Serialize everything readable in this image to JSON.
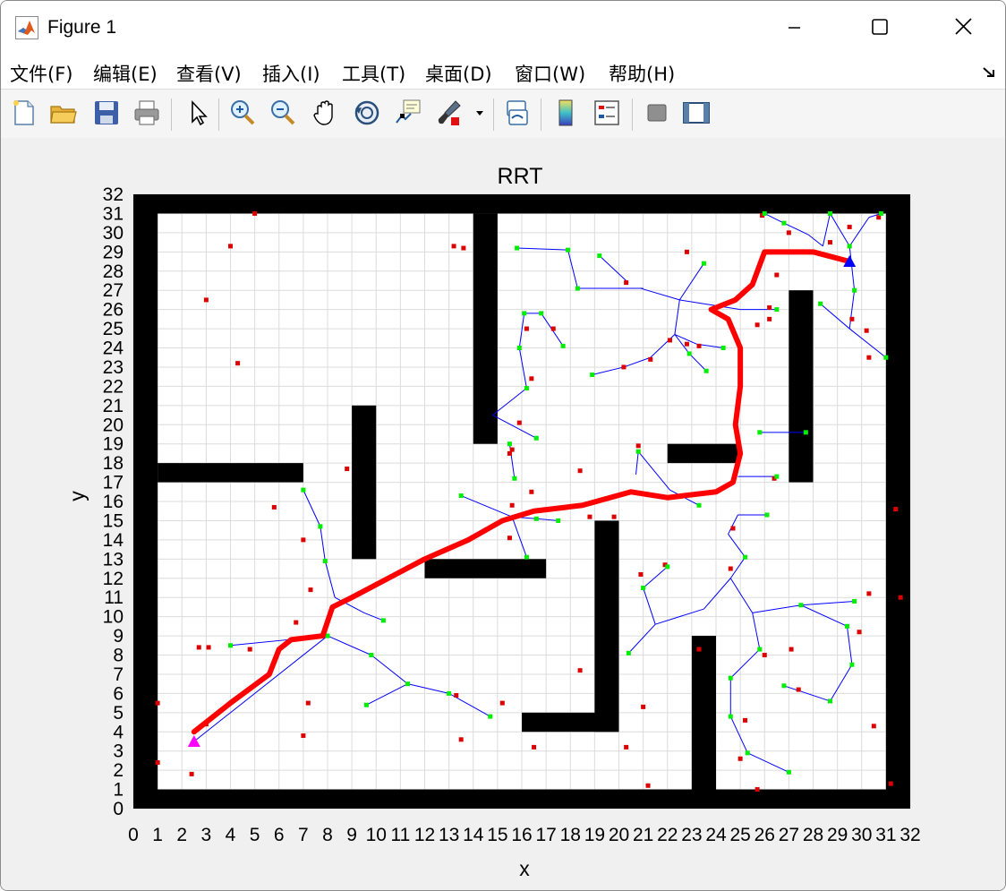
{
  "window": {
    "title": "Figure 1",
    "icon": "matlab-logo-icon",
    "controls": [
      "minimize-icon",
      "maximize-icon",
      "close-icon"
    ]
  },
  "menu": {
    "items": [
      {
        "label": "文件(F)",
        "name": "menu-file"
      },
      {
        "label": "编辑(E)",
        "name": "menu-edit"
      },
      {
        "label": "查看(V)",
        "name": "menu-view"
      },
      {
        "label": "插入(I)",
        "name": "menu-insert"
      },
      {
        "label": "工具(T)",
        "name": "menu-tools"
      },
      {
        "label": "桌面(D)",
        "name": "menu-desktop"
      },
      {
        "label": "窗口(W)",
        "name": "menu-window"
      },
      {
        "label": "帮助(H)",
        "name": "menu-help"
      }
    ]
  },
  "toolbar": {
    "icons": [
      "new-figure-icon",
      "open-file-icon",
      "save-icon",
      "print-icon",
      "pointer-icon",
      "zoom-in-icon",
      "zoom-out-icon",
      "pan-hand-icon",
      "rotate-3d-icon",
      "data-cursor-icon",
      "brush-icon",
      "brush-dropdown-icon",
      "link-plot-icon",
      "colorbar-icon",
      "legend-icon",
      "hide-plot-tools-icon",
      "show-plot-tools-icon"
    ]
  },
  "colors": {
    "path": "#ff0000",
    "tree": "#0000ff",
    "node": "#00ee00",
    "sample": "#dd0000",
    "obstacle": "#000000",
    "start": "#ff00ff",
    "goal": "#0000ff"
  },
  "chart_data": {
    "type": "scatter",
    "title": "RRT",
    "xlabel": "x",
    "ylabel": "y",
    "xlim": [
      0,
      32
    ],
    "ylim": [
      0,
      32
    ],
    "xticks": [
      "0",
      "1",
      "2",
      "3",
      "4",
      "5",
      "6",
      "7",
      "8",
      "9",
      "10",
      "11",
      "12",
      "13",
      "14",
      "15",
      "16",
      "17",
      "18",
      "19",
      "20",
      "21",
      "22",
      "23",
      "24",
      "25",
      "26",
      "27",
      "28",
      "29",
      "30",
      "31",
      "32"
    ],
    "yticks": [
      "0",
      "1",
      "2",
      "3",
      "4",
      "5",
      "6",
      "7",
      "8",
      "9",
      "10",
      "11",
      "12",
      "13",
      "14",
      "15",
      "16",
      "17",
      "18",
      "19",
      "20",
      "21",
      "22",
      "23",
      "24",
      "25",
      "26",
      "27",
      "28",
      "29",
      "30",
      "31",
      "32"
    ],
    "grid": true,
    "start": [
      2.5,
      3.5
    ],
    "goal": [
      29.5,
      28.5
    ],
    "obstacles": [
      [
        0,
        0,
        1,
        32
      ],
      [
        31,
        0,
        1,
        32
      ],
      [
        0,
        0,
        32,
        1
      ],
      [
        0,
        31,
        32,
        1
      ],
      [
        1,
        17,
        6,
        1
      ],
      [
        9,
        13,
        1,
        8
      ],
      [
        14,
        19,
        1,
        12
      ],
      [
        12,
        12,
        5,
        1
      ],
      [
        16,
        4,
        4,
        1
      ],
      [
        19,
        4,
        1,
        11
      ],
      [
        22,
        18,
        3,
        1
      ],
      [
        23,
        0,
        1,
        9
      ],
      [
        27,
        17,
        1,
        10
      ]
    ],
    "path": [
      [
        2.5,
        4
      ],
      [
        4,
        5.5
      ],
      [
        5.6,
        7
      ],
      [
        6,
        8.3
      ],
      [
        6.5,
        8.8
      ],
      [
        7.8,
        9
      ],
      [
        8.2,
        10.5
      ],
      [
        9,
        11
      ],
      [
        10.5,
        12
      ],
      [
        12,
        13
      ],
      [
        13.8,
        14
      ],
      [
        15.2,
        15
      ],
      [
        16.5,
        15.5
      ],
      [
        18.5,
        15.8
      ],
      [
        20.5,
        16.5
      ],
      [
        22,
        16.2
      ],
      [
        24,
        16.5
      ],
      [
        24.7,
        17
      ],
      [
        25,
        18.5
      ],
      [
        24.8,
        20
      ],
      [
        25,
        22
      ],
      [
        25,
        24
      ],
      [
        24.5,
        25.5
      ],
      [
        23.8,
        26
      ],
      [
        24.8,
        26.5
      ],
      [
        25.5,
        27.3
      ],
      [
        26,
        29
      ],
      [
        28,
        29
      ],
      [
        29.5,
        28.5
      ]
    ],
    "tree": [
      [
        [
          2.5,
          3.5
        ],
        [
          8,
          9
        ]
      ],
      [
        [
          4,
          8.5
        ],
        [
          8,
          9
        ]
      ],
      [
        [
          8,
          9
        ],
        [
          9.8,
          8
        ]
      ],
      [
        [
          9.8,
          8
        ],
        [
          11.3,
          6.5
        ]
      ],
      [
        [
          11.3,
          6.5
        ],
        [
          9.6,
          5.4
        ]
      ],
      [
        [
          11.3,
          6.5
        ],
        [
          13,
          6
        ]
      ],
      [
        [
          13,
          6
        ],
        [
          14.7,
          4.8
        ]
      ],
      [
        [
          7,
          16.6
        ],
        [
          7.7,
          14.7
        ]
      ],
      [
        [
          7.7,
          14.7
        ],
        [
          7.9,
          12.9
        ]
      ],
      [
        [
          7.9,
          12.9
        ],
        [
          8.3,
          11
        ]
      ],
      [
        [
          8.3,
          11
        ],
        [
          9.5,
          10.2
        ]
      ],
      [
        [
          9.5,
          10.2
        ],
        [
          10.3,
          9.8
        ]
      ],
      [
        [
          13.5,
          16.3
        ],
        [
          15.6,
          15.2
        ]
      ],
      [
        [
          15.6,
          15.2
        ],
        [
          16.6,
          15.1
        ]
      ],
      [
        [
          16.6,
          15.1
        ],
        [
          17.5,
          15
        ]
      ],
      [
        [
          15.6,
          15.2
        ],
        [
          16.2,
          13.1
        ]
      ],
      [
        [
          15.5,
          19
        ],
        [
          15.7,
          17.2
        ]
      ],
      [
        [
          14.8,
          20.5
        ],
        [
          16.2,
          21.9
        ]
      ],
      [
        [
          14.8,
          20.5
        ],
        [
          16.6,
          19.3
        ]
      ],
      [
        [
          16.2,
          21.9
        ],
        [
          15.9,
          24
        ]
      ],
      [
        [
          15.9,
          24
        ],
        [
          16.1,
          25.8
        ]
      ],
      [
        [
          16.1,
          25.8
        ],
        [
          16.8,
          25.8
        ]
      ],
      [
        [
          16.8,
          25.8
        ],
        [
          17.7,
          24.1
        ]
      ],
      [
        [
          15.8,
          29.2
        ],
        [
          17.9,
          29.1
        ]
      ],
      [
        [
          17.9,
          29.1
        ],
        [
          18.3,
          27.1
        ]
      ],
      [
        [
          18.3,
          27.1
        ],
        [
          20.9,
          27.1
        ]
      ],
      [
        [
          18.3,
          27.1
        ],
        [
          21,
          27.1
        ]
      ],
      [
        [
          19.2,
          28.8
        ],
        [
          20.3,
          27.5
        ]
      ],
      [
        [
          20.9,
          27.1
        ],
        [
          22.5,
          26.5
        ]
      ],
      [
        [
          22.5,
          26.5
        ],
        [
          23.5,
          28.4
        ]
      ],
      [
        [
          22.5,
          26.5
        ],
        [
          22.3,
          24.7
        ]
      ],
      [
        [
          22.3,
          24.7
        ],
        [
          22.9,
          23.7
        ]
      ],
      [
        [
          22.9,
          23.7
        ],
        [
          23.6,
          22.8
        ]
      ],
      [
        [
          22.3,
          24.7
        ],
        [
          23.2,
          24.2
        ]
      ],
      [
        [
          23.2,
          24.2
        ],
        [
          24.3,
          24
        ]
      ],
      [
        [
          22.5,
          26.5
        ],
        [
          25,
          26
        ]
      ],
      [
        [
          25,
          26
        ],
        [
          26.5,
          26
        ]
      ],
      [
        [
          18.9,
          22.6
        ],
        [
          20.2,
          23
        ]
      ],
      [
        [
          20.2,
          23
        ],
        [
          21.3,
          23.5
        ]
      ],
      [
        [
          21.3,
          23.5
        ],
        [
          22.3,
          24.7
        ]
      ],
      [
        [
          25.8,
          19.6
        ],
        [
          27.7,
          19.6
        ]
      ],
      [
        [
          24.9,
          17.3
        ],
        [
          26.5,
          17.3
        ]
      ],
      [
        [
          20.7,
          17.4
        ],
        [
          20.8,
          18.6
        ]
      ],
      [
        [
          20.8,
          18.6
        ],
        [
          22.1,
          16.6
        ]
      ],
      [
        [
          22.1,
          16.6
        ],
        [
          23.3,
          15.8
        ]
      ],
      [
        [
          24.9,
          15.3
        ],
        [
          26.1,
          15.3
        ]
      ],
      [
        [
          24.9,
          15.3
        ],
        [
          24.5,
          14.3
        ]
      ],
      [
        [
          24.5,
          14.3
        ],
        [
          25.2,
          13.1
        ]
      ],
      [
        [
          25.2,
          13.1
        ],
        [
          24.6,
          12
        ]
      ],
      [
        [
          24.6,
          12
        ],
        [
          23.5,
          10.4
        ]
      ],
      [
        [
          23.5,
          10.4
        ],
        [
          21.5,
          9.6
        ]
      ],
      [
        [
          21.5,
          9.6
        ],
        [
          21,
          11.5
        ]
      ],
      [
        [
          21,
          11.5
        ],
        [
          22,
          12.6
        ]
      ],
      [
        [
          21.5,
          9.6
        ],
        [
          20.4,
          8.1
        ]
      ],
      [
        [
          24.6,
          12
        ],
        [
          25.5,
          10.2
        ]
      ],
      [
        [
          25.5,
          10.2
        ],
        [
          27.5,
          10.6
        ]
      ],
      [
        [
          27.5,
          10.6
        ],
        [
          29.4,
          9.5
        ]
      ],
      [
        [
          29.4,
          9.5
        ],
        [
          29.6,
          7.5
        ]
      ],
      [
        [
          29.6,
          7.5
        ],
        [
          28.7,
          5.6
        ]
      ],
      [
        [
          28.7,
          5.6
        ],
        [
          26.8,
          6.4
        ]
      ],
      [
        [
          27.5,
          10.6
        ],
        [
          29.7,
          10.8
        ]
      ],
      [
        [
          25.5,
          10.2
        ],
        [
          25.8,
          8.3
        ]
      ],
      [
        [
          25.8,
          8.3
        ],
        [
          24.6,
          6.8
        ]
      ],
      [
        [
          24.6,
          6.8
        ],
        [
          24.6,
          4.8
        ]
      ],
      [
        [
          24.6,
          4.8
        ],
        [
          25.3,
          2.9
        ]
      ],
      [
        [
          25.3,
          2.9
        ],
        [
          27,
          1.9
        ]
      ],
      [
        [
          26,
          31
        ],
        [
          26.8,
          30.5
        ]
      ],
      [
        [
          26.8,
          30.5
        ],
        [
          27.8,
          29.9
        ]
      ],
      [
        [
          27.8,
          29.9
        ],
        [
          28.4,
          29.3
        ]
      ],
      [
        [
          28.4,
          29.3
        ],
        [
          28.7,
          31
        ]
      ],
      [
        [
          28.7,
          31
        ],
        [
          29.5,
          29.3
        ]
      ],
      [
        [
          29.5,
          29.3
        ],
        [
          30.3,
          30.8
        ]
      ],
      [
        [
          30.3,
          30.8
        ],
        [
          30.8,
          31
        ]
      ],
      [
        [
          29.5,
          29.3
        ],
        [
          29.7,
          27
        ]
      ],
      [
        [
          29.7,
          27
        ],
        [
          29.5,
          25
        ]
      ],
      [
        [
          29.5,
          25
        ],
        [
          31,
          23.5
        ]
      ],
      [
        [
          29.5,
          25
        ],
        [
          28.3,
          26.3
        ]
      ]
    ],
    "nodes": [
      [
        2.5,
        3.5
      ],
      [
        4,
        8.5
      ],
      [
        8,
        9
      ],
      [
        9.8,
        8
      ],
      [
        11.3,
        6.5
      ],
      [
        9.6,
        5.4
      ],
      [
        13,
        6
      ],
      [
        14.7,
        4.8
      ],
      [
        7,
        16.6
      ],
      [
        7.7,
        14.7
      ],
      [
        7.9,
        12.9
      ],
      [
        10.3,
        9.8
      ],
      [
        13.5,
        16.3
      ],
      [
        16.6,
        15.1
      ],
      [
        17.5,
        15
      ],
      [
        16.2,
        13.1
      ],
      [
        15.5,
        19
      ],
      [
        15.7,
        17.2
      ],
      [
        16.2,
        21.9
      ],
      [
        16.6,
        19.3
      ],
      [
        15.9,
        24
      ],
      [
        16.1,
        25.8
      ],
      [
        16.8,
        25.8
      ],
      [
        17.7,
        24.1
      ],
      [
        15.8,
        29.2
      ],
      [
        17.9,
        29.1
      ],
      [
        18.3,
        27.1
      ],
      [
        19.2,
        28.8
      ],
      [
        23.5,
        28.4
      ],
      [
        22.9,
        23.7
      ],
      [
        23.6,
        22.8
      ],
      [
        24.3,
        24
      ],
      [
        18.9,
        22.6
      ],
      [
        25.8,
        19.6
      ],
      [
        27.7,
        19.6
      ],
      [
        26.5,
        17.3
      ],
      [
        20.8,
        18.6
      ],
      [
        23.3,
        15.8
      ],
      [
        26.1,
        15.3
      ],
      [
        25.2,
        13.1
      ],
      [
        22,
        12.6
      ],
      [
        21,
        11.5
      ],
      [
        20.4,
        8.1
      ],
      [
        27.5,
        10.6
      ],
      [
        29.4,
        9.5
      ],
      [
        29.6,
        7.5
      ],
      [
        28.7,
        5.6
      ],
      [
        26.8,
        6.4
      ],
      [
        29.7,
        10.8
      ],
      [
        25.8,
        8.3
      ],
      [
        24.6,
        6.8
      ],
      [
        24.6,
        4.8
      ],
      [
        25.3,
        2.9
      ],
      [
        27,
        1.9
      ],
      [
        26,
        31
      ],
      [
        26.5,
        26
      ],
      [
        26.8,
        30.5
      ],
      [
        28.7,
        31
      ],
      [
        29.5,
        29.3
      ],
      [
        30.8,
        31
      ],
      [
        29.7,
        27
      ],
      [
        31,
        23.5
      ],
      [
        28.3,
        26.3
      ]
    ],
    "samples": [
      [
        4,
        29.3
      ],
      [
        3,
        26.5
      ],
      [
        4.3,
        23.2
      ],
      [
        5,
        31
      ],
      [
        13.2,
        29.3
      ],
      [
        13.6,
        29.2
      ],
      [
        22.8,
        29
      ],
      [
        8.8,
        17.7
      ],
      [
        5.8,
        15.7
      ],
      [
        7,
        14
      ],
      [
        7.3,
        11.4
      ],
      [
        6.7,
        9.7
      ],
      [
        2.7,
        8.4
      ],
      [
        3.1,
        8.4
      ],
      [
        4.8,
        8.3
      ],
      [
        3,
        4.4
      ],
      [
        1,
        5.5
      ],
      [
        1,
        2.4
      ],
      [
        2.4,
        1.8
      ],
      [
        7.2,
        5.5
      ],
      [
        7,
        3.8
      ],
      [
        13.3,
        5.9
      ],
      [
        13.5,
        3.6
      ],
      [
        15.2,
        5.5
      ],
      [
        16.5,
        3.2
      ],
      [
        18.4,
        7.2
      ],
      [
        21,
        5.3
      ],
      [
        20.3,
        3.2
      ],
      [
        21.2,
        1.2
      ],
      [
        18.4,
        17.6
      ],
      [
        18.8,
        15.2
      ],
      [
        19.8,
        15.2
      ],
      [
        20.8,
        18.9
      ],
      [
        15.5,
        18.5
      ],
      [
        16.4,
        16.5
      ],
      [
        15.6,
        15.8
      ],
      [
        15.5,
        14.1
      ],
      [
        20.9,
        12.2
      ],
      [
        21.9,
        12.7
      ],
      [
        23.3,
        8.3
      ],
      [
        24.7,
        14.6
      ],
      [
        24.6,
        12.5
      ],
      [
        26,
        8
      ],
      [
        27.1,
        8.3
      ],
      [
        27.4,
        6.2
      ],
      [
        29.9,
        9.2
      ],
      [
        30.3,
        11.2
      ],
      [
        31.6,
        11
      ],
      [
        31.4,
        15.6
      ],
      [
        30.5,
        4.3
      ],
      [
        25.2,
        4.6
      ],
      [
        25,
        2.6
      ],
      [
        31.2,
        1.3
      ],
      [
        25.7,
        1
      ],
      [
        29.6,
        25.5
      ],
      [
        30.2,
        24.9
      ],
      [
        30.3,
        23.5
      ],
      [
        28.7,
        29.5
      ],
      [
        29.5,
        30.3
      ],
      [
        30.7,
        30.8
      ],
      [
        27,
        30
      ],
      [
        25.9,
        30.9
      ],
      [
        26.5,
        27.8
      ],
      [
        26.2,
        26.1
      ],
      [
        25.7,
        25.2
      ],
      [
        26.2,
        25.5
      ],
      [
        21.3,
        23.4
      ],
      [
        22.1,
        24.4
      ],
      [
        22.8,
        24.2
      ],
      [
        23.3,
        24.1
      ],
      [
        20.2,
        23
      ],
      [
        20.3,
        27.4
      ],
      [
        16.2,
        25
      ],
      [
        17.3,
        25
      ],
      [
        16.4,
        22.4
      ],
      [
        15.9,
        20.1
      ],
      [
        15.6,
        18.7
      ],
      [
        26.4,
        17.2
      ]
    ]
  }
}
